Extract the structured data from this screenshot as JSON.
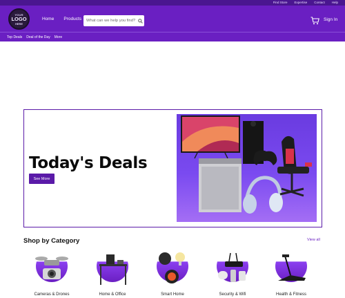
{
  "utility_nav": [
    "Find Store",
    "Expertise",
    "Contact",
    "Help"
  ],
  "logo": {
    "line1": "YOUR",
    "line2": "LOGO",
    "line3": "HERE"
  },
  "main_nav": [
    "Home",
    "Products"
  ],
  "search": {
    "placeholder": "What can we help you find?"
  },
  "header": {
    "sign_in": "Sign In"
  },
  "sub_nav": [
    "Top Deals",
    "Deal of the Day",
    "More"
  ],
  "hero": {
    "title": "Today's Deals",
    "button": "See More"
  },
  "categories_section": {
    "title": "Shop by Category",
    "view_all": "View all",
    "items": [
      {
        "label": "Cameras & Drones",
        "icon": "drone-camera-icon"
      },
      {
        "label": "Home & Office",
        "icon": "desk-chair-icon"
      },
      {
        "label": "Smart Home",
        "icon": "smart-speaker-icon"
      },
      {
        "label": "Security & Wifi",
        "icon": "router-icon"
      },
      {
        "label": "Health & Fitness",
        "icon": "treadmill-icon"
      }
    ]
  },
  "colors": {
    "brand_purple": "#6a1fc2",
    "dark_purple": "#4a1690",
    "hero_border": "#5a1aa8"
  }
}
